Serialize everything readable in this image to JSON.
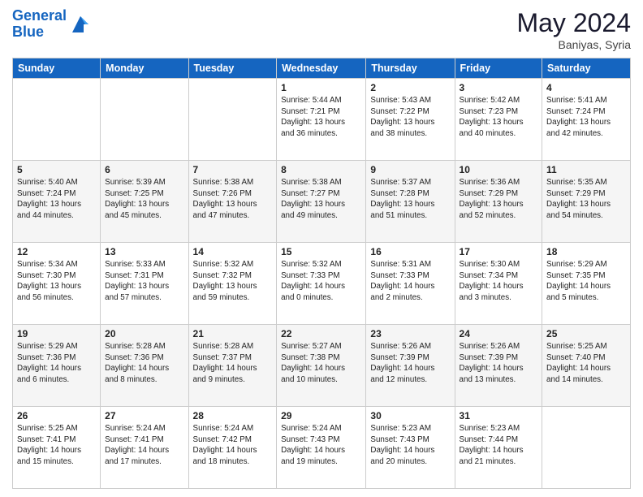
{
  "header": {
    "logo_line1": "General",
    "logo_line2": "Blue",
    "month": "May 2024",
    "location": "Baniyas, Syria"
  },
  "weekdays": [
    "Sunday",
    "Monday",
    "Tuesday",
    "Wednesday",
    "Thursday",
    "Friday",
    "Saturday"
  ],
  "weeks": [
    [
      {
        "day": "",
        "info": ""
      },
      {
        "day": "",
        "info": ""
      },
      {
        "day": "",
        "info": ""
      },
      {
        "day": "1",
        "info": "Sunrise: 5:44 AM\nSunset: 7:21 PM\nDaylight: 13 hours\nand 36 minutes."
      },
      {
        "day": "2",
        "info": "Sunrise: 5:43 AM\nSunset: 7:22 PM\nDaylight: 13 hours\nand 38 minutes."
      },
      {
        "day": "3",
        "info": "Sunrise: 5:42 AM\nSunset: 7:23 PM\nDaylight: 13 hours\nand 40 minutes."
      },
      {
        "day": "4",
        "info": "Sunrise: 5:41 AM\nSunset: 7:24 PM\nDaylight: 13 hours\nand 42 minutes."
      }
    ],
    [
      {
        "day": "5",
        "info": "Sunrise: 5:40 AM\nSunset: 7:24 PM\nDaylight: 13 hours\nand 44 minutes."
      },
      {
        "day": "6",
        "info": "Sunrise: 5:39 AM\nSunset: 7:25 PM\nDaylight: 13 hours\nand 45 minutes."
      },
      {
        "day": "7",
        "info": "Sunrise: 5:38 AM\nSunset: 7:26 PM\nDaylight: 13 hours\nand 47 minutes."
      },
      {
        "day": "8",
        "info": "Sunrise: 5:38 AM\nSunset: 7:27 PM\nDaylight: 13 hours\nand 49 minutes."
      },
      {
        "day": "9",
        "info": "Sunrise: 5:37 AM\nSunset: 7:28 PM\nDaylight: 13 hours\nand 51 minutes."
      },
      {
        "day": "10",
        "info": "Sunrise: 5:36 AM\nSunset: 7:29 PM\nDaylight: 13 hours\nand 52 minutes."
      },
      {
        "day": "11",
        "info": "Sunrise: 5:35 AM\nSunset: 7:29 PM\nDaylight: 13 hours\nand 54 minutes."
      }
    ],
    [
      {
        "day": "12",
        "info": "Sunrise: 5:34 AM\nSunset: 7:30 PM\nDaylight: 13 hours\nand 56 minutes."
      },
      {
        "day": "13",
        "info": "Sunrise: 5:33 AM\nSunset: 7:31 PM\nDaylight: 13 hours\nand 57 minutes."
      },
      {
        "day": "14",
        "info": "Sunrise: 5:32 AM\nSunset: 7:32 PM\nDaylight: 13 hours\nand 59 minutes."
      },
      {
        "day": "15",
        "info": "Sunrise: 5:32 AM\nSunset: 7:33 PM\nDaylight: 14 hours\nand 0 minutes."
      },
      {
        "day": "16",
        "info": "Sunrise: 5:31 AM\nSunset: 7:33 PM\nDaylight: 14 hours\nand 2 minutes."
      },
      {
        "day": "17",
        "info": "Sunrise: 5:30 AM\nSunset: 7:34 PM\nDaylight: 14 hours\nand 3 minutes."
      },
      {
        "day": "18",
        "info": "Sunrise: 5:29 AM\nSunset: 7:35 PM\nDaylight: 14 hours\nand 5 minutes."
      }
    ],
    [
      {
        "day": "19",
        "info": "Sunrise: 5:29 AM\nSunset: 7:36 PM\nDaylight: 14 hours\nand 6 minutes."
      },
      {
        "day": "20",
        "info": "Sunrise: 5:28 AM\nSunset: 7:36 PM\nDaylight: 14 hours\nand 8 minutes."
      },
      {
        "day": "21",
        "info": "Sunrise: 5:28 AM\nSunset: 7:37 PM\nDaylight: 14 hours\nand 9 minutes."
      },
      {
        "day": "22",
        "info": "Sunrise: 5:27 AM\nSunset: 7:38 PM\nDaylight: 14 hours\nand 10 minutes."
      },
      {
        "day": "23",
        "info": "Sunrise: 5:26 AM\nSunset: 7:39 PM\nDaylight: 14 hours\nand 12 minutes."
      },
      {
        "day": "24",
        "info": "Sunrise: 5:26 AM\nSunset: 7:39 PM\nDaylight: 14 hours\nand 13 minutes."
      },
      {
        "day": "25",
        "info": "Sunrise: 5:25 AM\nSunset: 7:40 PM\nDaylight: 14 hours\nand 14 minutes."
      }
    ],
    [
      {
        "day": "26",
        "info": "Sunrise: 5:25 AM\nSunset: 7:41 PM\nDaylight: 14 hours\nand 15 minutes."
      },
      {
        "day": "27",
        "info": "Sunrise: 5:24 AM\nSunset: 7:41 PM\nDaylight: 14 hours\nand 17 minutes."
      },
      {
        "day": "28",
        "info": "Sunrise: 5:24 AM\nSunset: 7:42 PM\nDaylight: 14 hours\nand 18 minutes."
      },
      {
        "day": "29",
        "info": "Sunrise: 5:24 AM\nSunset: 7:43 PM\nDaylight: 14 hours\nand 19 minutes."
      },
      {
        "day": "30",
        "info": "Sunrise: 5:23 AM\nSunset: 7:43 PM\nDaylight: 14 hours\nand 20 minutes."
      },
      {
        "day": "31",
        "info": "Sunrise: 5:23 AM\nSunset: 7:44 PM\nDaylight: 14 hours\nand 21 minutes."
      },
      {
        "day": "",
        "info": ""
      }
    ]
  ]
}
